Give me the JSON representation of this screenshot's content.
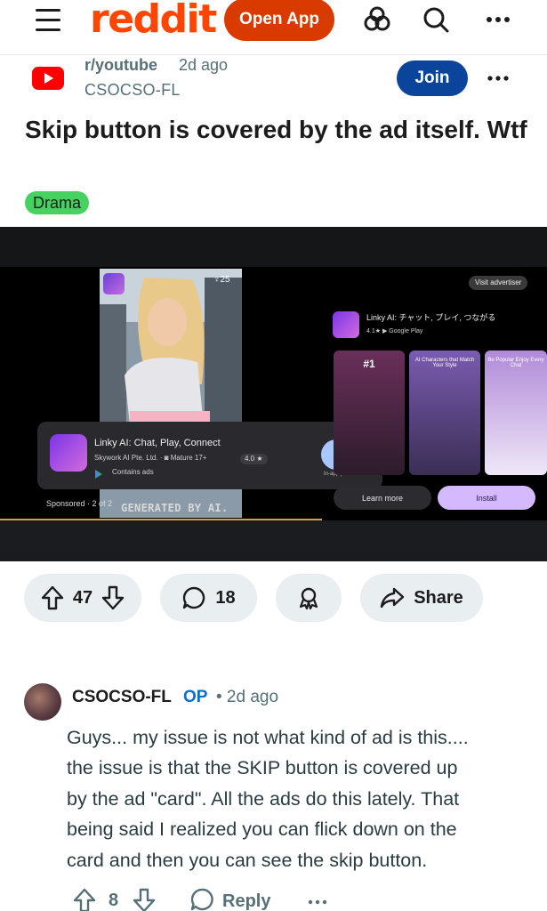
{
  "topbar": {
    "logo": "reddit",
    "open_app_label": "Open App"
  },
  "post": {
    "subreddit": "r/youtube",
    "time": "2d ago",
    "author": "CSOCSO-FL",
    "join_label": "Join",
    "title": "Skip button is covered by the ad itself. Wtf",
    "flair": "Drama",
    "flair_color": "#46D160",
    "upvotes": "47",
    "comments": "18",
    "share_label": "Share"
  },
  "media": {
    "viewer_count": "25",
    "ad_title": "Linky AI: Chat, Play, Connect",
    "ad_developer": "Skywork AI Pte. Ltd.",
    "ad_maturity": "Mature 17+",
    "ad_rating": "4.0 ★",
    "ad_contains": "Contains ads",
    "ad_install": "Install",
    "ad_in_app": "In-app purchases",
    "sponsored": "Sponsored · 2 of 2",
    "generated_watermark": "GENERATED BY AI.",
    "visit_advertiser": "Visit advertiser",
    "store_title": "Linky AI: チャット, プレイ, つながる",
    "store_rating": "4.1★",
    "store_source": "Google Play",
    "shot_labels": [
      "#1",
      "AI Characters that Match Your Style",
      "Be Popular Enjoy Every Chat"
    ],
    "learn_more": "Learn more",
    "install_big": "Install"
  },
  "comment": {
    "author": "CSOCSO-FL",
    "op_badge": "OP",
    "time": "• 2d ago",
    "lines": [
      "Guys... my issue is not what kind of ad is this....",
      "the issue is that the SKIP button is covered up",
      "by the ad \"card\". All the ads do this lately. That",
      "being said I realized you can flick down on the",
      "card and then you can see the skip button."
    ],
    "votes": "8",
    "reply_label": "Reply"
  },
  "colors": {
    "brand": "#FF4500",
    "open_app_bg": "#D93A00",
    "join_bg": "#0A449B",
    "op_color": "#0A6FD1"
  },
  "icons": [
    "menu-icon",
    "reddit-logo",
    "games-icon",
    "search-icon",
    "more-icon",
    "youtube-icon",
    "upvote-icon",
    "downvote-icon",
    "comment-icon",
    "award-icon",
    "share-icon",
    "reply-icon"
  ]
}
